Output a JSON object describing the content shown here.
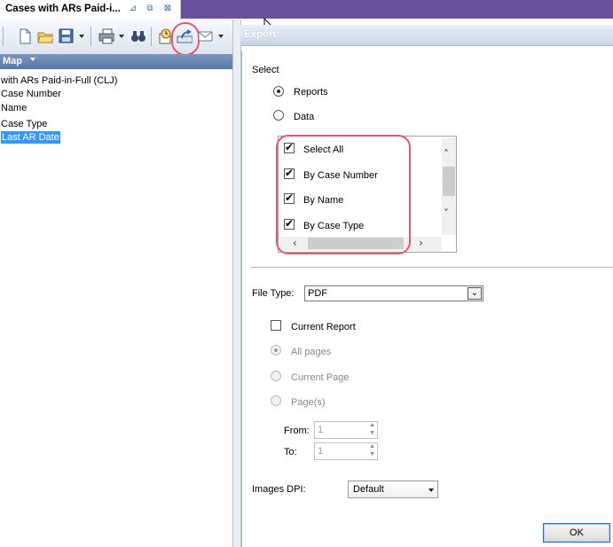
{
  "window": {
    "doc_tab_title": "Cases with ARs Paid-i...",
    "tab_icons": [
      "pin-icon",
      "float-icon",
      "close-icon"
    ]
  },
  "toolbar": {
    "icons": [
      "new-document-icon",
      "open-folder-icon",
      "save-icon",
      "print-icon",
      "find-binoculars-icon",
      "schedule-icon",
      "export-icon",
      "email-icon"
    ],
    "highlight_color": "#e8566e"
  },
  "map_panel": {
    "header": "Map",
    "items": [
      "with ARs Paid-in-Full (CLJ)",
      "Case Number",
      "Name",
      "Case Type",
      "Last AR Date"
    ],
    "selected_item": "Last AR Date",
    "selection_color": "#3399ff"
  },
  "export": {
    "title": "Export",
    "select_label": "Select",
    "radio_reports": "Reports",
    "radio_data": "Data",
    "selected_source": "Reports",
    "report_list": [
      {
        "label": "Select All",
        "checked": true
      },
      {
        "label": "By Case Number",
        "checked": true
      },
      {
        "label": "By Name",
        "checked": true
      },
      {
        "label": "By Case Type",
        "checked": true
      }
    ],
    "file_type_label": "File Type:",
    "file_type_value": "PDF",
    "current_report_label": "Current Report",
    "current_report_checked": false,
    "page_options": [
      "All pages",
      "Current Page",
      "Page(s)"
    ],
    "page_option_selected": "All pages",
    "from_label": "From:",
    "from_value": "1",
    "to_label": "To:",
    "to_value": "1",
    "dpi_label": "Images DPI:",
    "dpi_value": "Default",
    "ok_label": "OK"
  }
}
